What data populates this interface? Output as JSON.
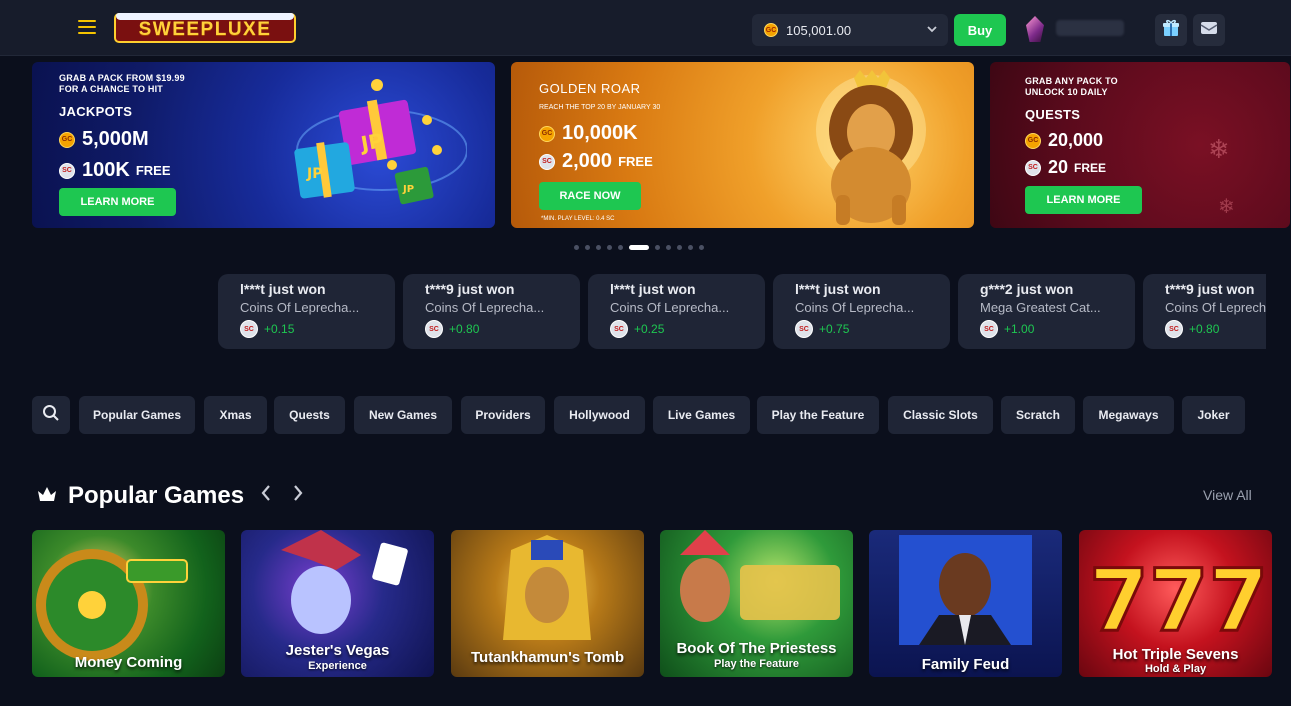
{
  "header": {
    "logo_text": "SWEEPLUXE",
    "balance": "105,001.00",
    "buy_label": "Buy"
  },
  "banners": [
    {
      "small": "GRAB A PACK FROM $19.99 FOR A CHANCE TO HIT",
      "title": "JACKPOTS",
      "gc_amount": "5,000M",
      "sc_amount": "100K",
      "free_label": "FREE",
      "button": "LEARN MORE"
    },
    {
      "title": "GOLDEN ROAR",
      "small": "REACH THE TOP 20 BY JANUARY 30",
      "gc_amount": "10,000K",
      "sc_amount": "2,000",
      "free_label": "FREE",
      "button": "RACE NOW",
      "note": "*MIN. PLAY LEVEL: 0.4 SC"
    },
    {
      "small": "GRAB ANY PACK TO UNLOCK 10 DAILY",
      "title": "QUESTS",
      "gc_amount": "20,000",
      "sc_amount": "20",
      "free_label": "FREE",
      "button": "LEARN MORE"
    }
  ],
  "carousel_dots": {
    "count": 11,
    "active_index": 5
  },
  "recent_wins": [
    {
      "who": "l***t just won",
      "game": "Coins Of Leprecha...",
      "amount": "+0.15"
    },
    {
      "who": "t***9 just won",
      "game": "Coins Of Leprecha...",
      "amount": "+0.80"
    },
    {
      "who": "l***t just won",
      "game": "Coins Of Leprecha...",
      "amount": "+0.25"
    },
    {
      "who": "l***t just won",
      "game": "Coins Of Leprecha...",
      "amount": "+0.75"
    },
    {
      "who": "g***2 just won",
      "game": "Mega Greatest Cat...",
      "amount": "+1.00"
    },
    {
      "who": "t***9 just won",
      "game": "Coins Of Leprecha...",
      "amount": "+0.80"
    }
  ],
  "filters": [
    "Popular Games",
    "Xmas",
    "Quests",
    "New Games",
    "Providers",
    "Hollywood",
    "Live Games",
    "Play the Feature",
    "Classic Slots",
    "Scratch",
    "Megaways",
    "Joker"
  ],
  "section": {
    "title": "Popular Games",
    "view_all": "View All"
  },
  "games": [
    {
      "name": "Money Coming",
      "sub": ""
    },
    {
      "name": "Jester's Vegas",
      "sub": "Experience"
    },
    {
      "name": "Tutankhamun's Tomb",
      "sub": ""
    },
    {
      "name": "Book Of The Priestess",
      "sub": "Play the Feature"
    },
    {
      "name": "Family Feud",
      "sub": ""
    },
    {
      "name": "Hot Triple Sevens",
      "sub": "Hold & Play"
    }
  ],
  "coin_labels": {
    "gc": "GC",
    "sc": "SC"
  }
}
